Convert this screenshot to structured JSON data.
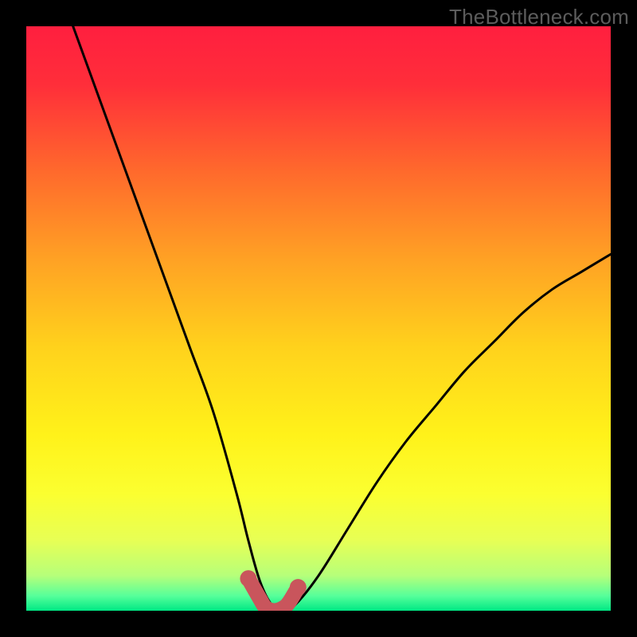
{
  "watermark": "TheBottleneck.com",
  "chart_data": {
    "type": "line",
    "title": "",
    "xlabel": "",
    "ylabel": "",
    "xlim": [
      0,
      100
    ],
    "ylim": [
      0,
      100
    ],
    "series": [
      {
        "name": "curve",
        "x": [
          8,
          12,
          16,
          20,
          24,
          28,
          32,
          36,
          38,
          40,
          42,
          44,
          46,
          50,
          55,
          60,
          65,
          70,
          75,
          80,
          85,
          90,
          95,
          100
        ],
        "y": [
          100,
          89,
          78,
          67,
          56,
          45,
          34,
          20,
          12,
          5,
          1,
          0,
          1,
          6,
          14,
          22,
          29,
          35,
          41,
          46,
          51,
          55,
          58,
          61
        ]
      },
      {
        "name": "highlight",
        "x": [
          38,
          40,
          41,
          42.5,
          44,
          45,
          46.5
        ],
        "y": [
          5.5,
          2,
          0.5,
          0,
          0.5,
          1.5,
          4
        ]
      }
    ],
    "gradient_stops": [
      {
        "offset": 0.0,
        "color": "#ff1f3f"
      },
      {
        "offset": 0.1,
        "color": "#ff2e3a"
      },
      {
        "offset": 0.25,
        "color": "#ff6a2c"
      },
      {
        "offset": 0.4,
        "color": "#ffa224"
      },
      {
        "offset": 0.55,
        "color": "#ffd21c"
      },
      {
        "offset": 0.7,
        "color": "#fff21a"
      },
      {
        "offset": 0.8,
        "color": "#fbff30"
      },
      {
        "offset": 0.88,
        "color": "#e7ff55"
      },
      {
        "offset": 0.94,
        "color": "#b6ff7a"
      },
      {
        "offset": 0.975,
        "color": "#55ff9a"
      },
      {
        "offset": 1.0,
        "color": "#00e884"
      }
    ],
    "colors": {
      "curve": "#000000",
      "highlight": "#c9555c"
    }
  }
}
